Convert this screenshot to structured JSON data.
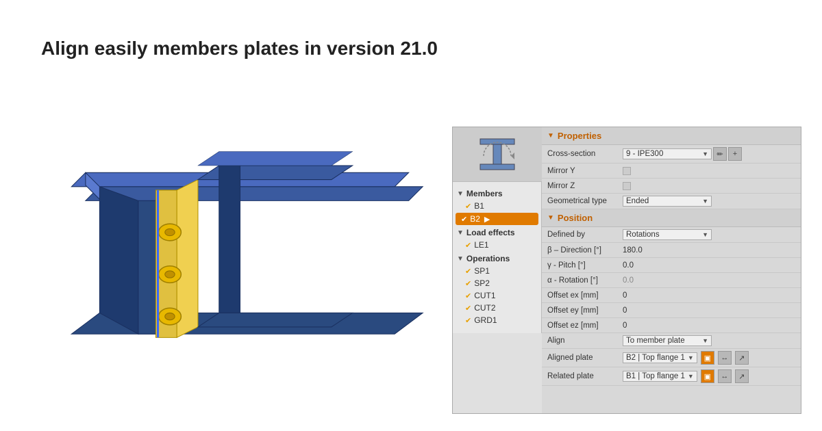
{
  "title": "Align easily members plates in version 21.0",
  "panel": {
    "properties_label": "Properties",
    "position_label": "Position",
    "cross_section_label": "Cross-section",
    "cross_section_value": "9 - IPE300",
    "mirror_y_label": "Mirror Y",
    "mirror_z_label": "Mirror Z",
    "geometrical_type_label": "Geometrical type",
    "geometrical_type_value": "Ended",
    "defined_by_label": "Defined by",
    "defined_by_value": "Rotations",
    "direction_label": "β – Direction [°]",
    "direction_value": "180.0",
    "pitch_label": "γ - Pitch [°]",
    "pitch_value": "0.0",
    "rotation_label": "α - Rotation [°]",
    "rotation_value": "0.0",
    "offset_ex_label": "Offset ex [mm]",
    "offset_ex_value": "0",
    "offset_ey_label": "Offset ey [mm]",
    "offset_ey_value": "0",
    "offset_ez_label": "Offset ez [mm]",
    "offset_ez_value": "0",
    "align_label": "Align",
    "align_value": "To member plate",
    "aligned_plate_label": "Aligned plate",
    "aligned_plate_value": "B2 | Top flange 1",
    "related_plate_label": "Related plate",
    "related_plate_value": "B1 | Top flange 1"
  },
  "tree": {
    "members_label": "Members",
    "b1_label": "B1",
    "b2_label": "B2",
    "load_effects_label": "Load effects",
    "le1_label": "LE1",
    "operations_label": "Operations",
    "sp1_label": "SP1",
    "sp2_label": "SP2",
    "cut1_label": "CUT1",
    "cut2_label": "CUT2",
    "grd1_label": "GRD1"
  }
}
